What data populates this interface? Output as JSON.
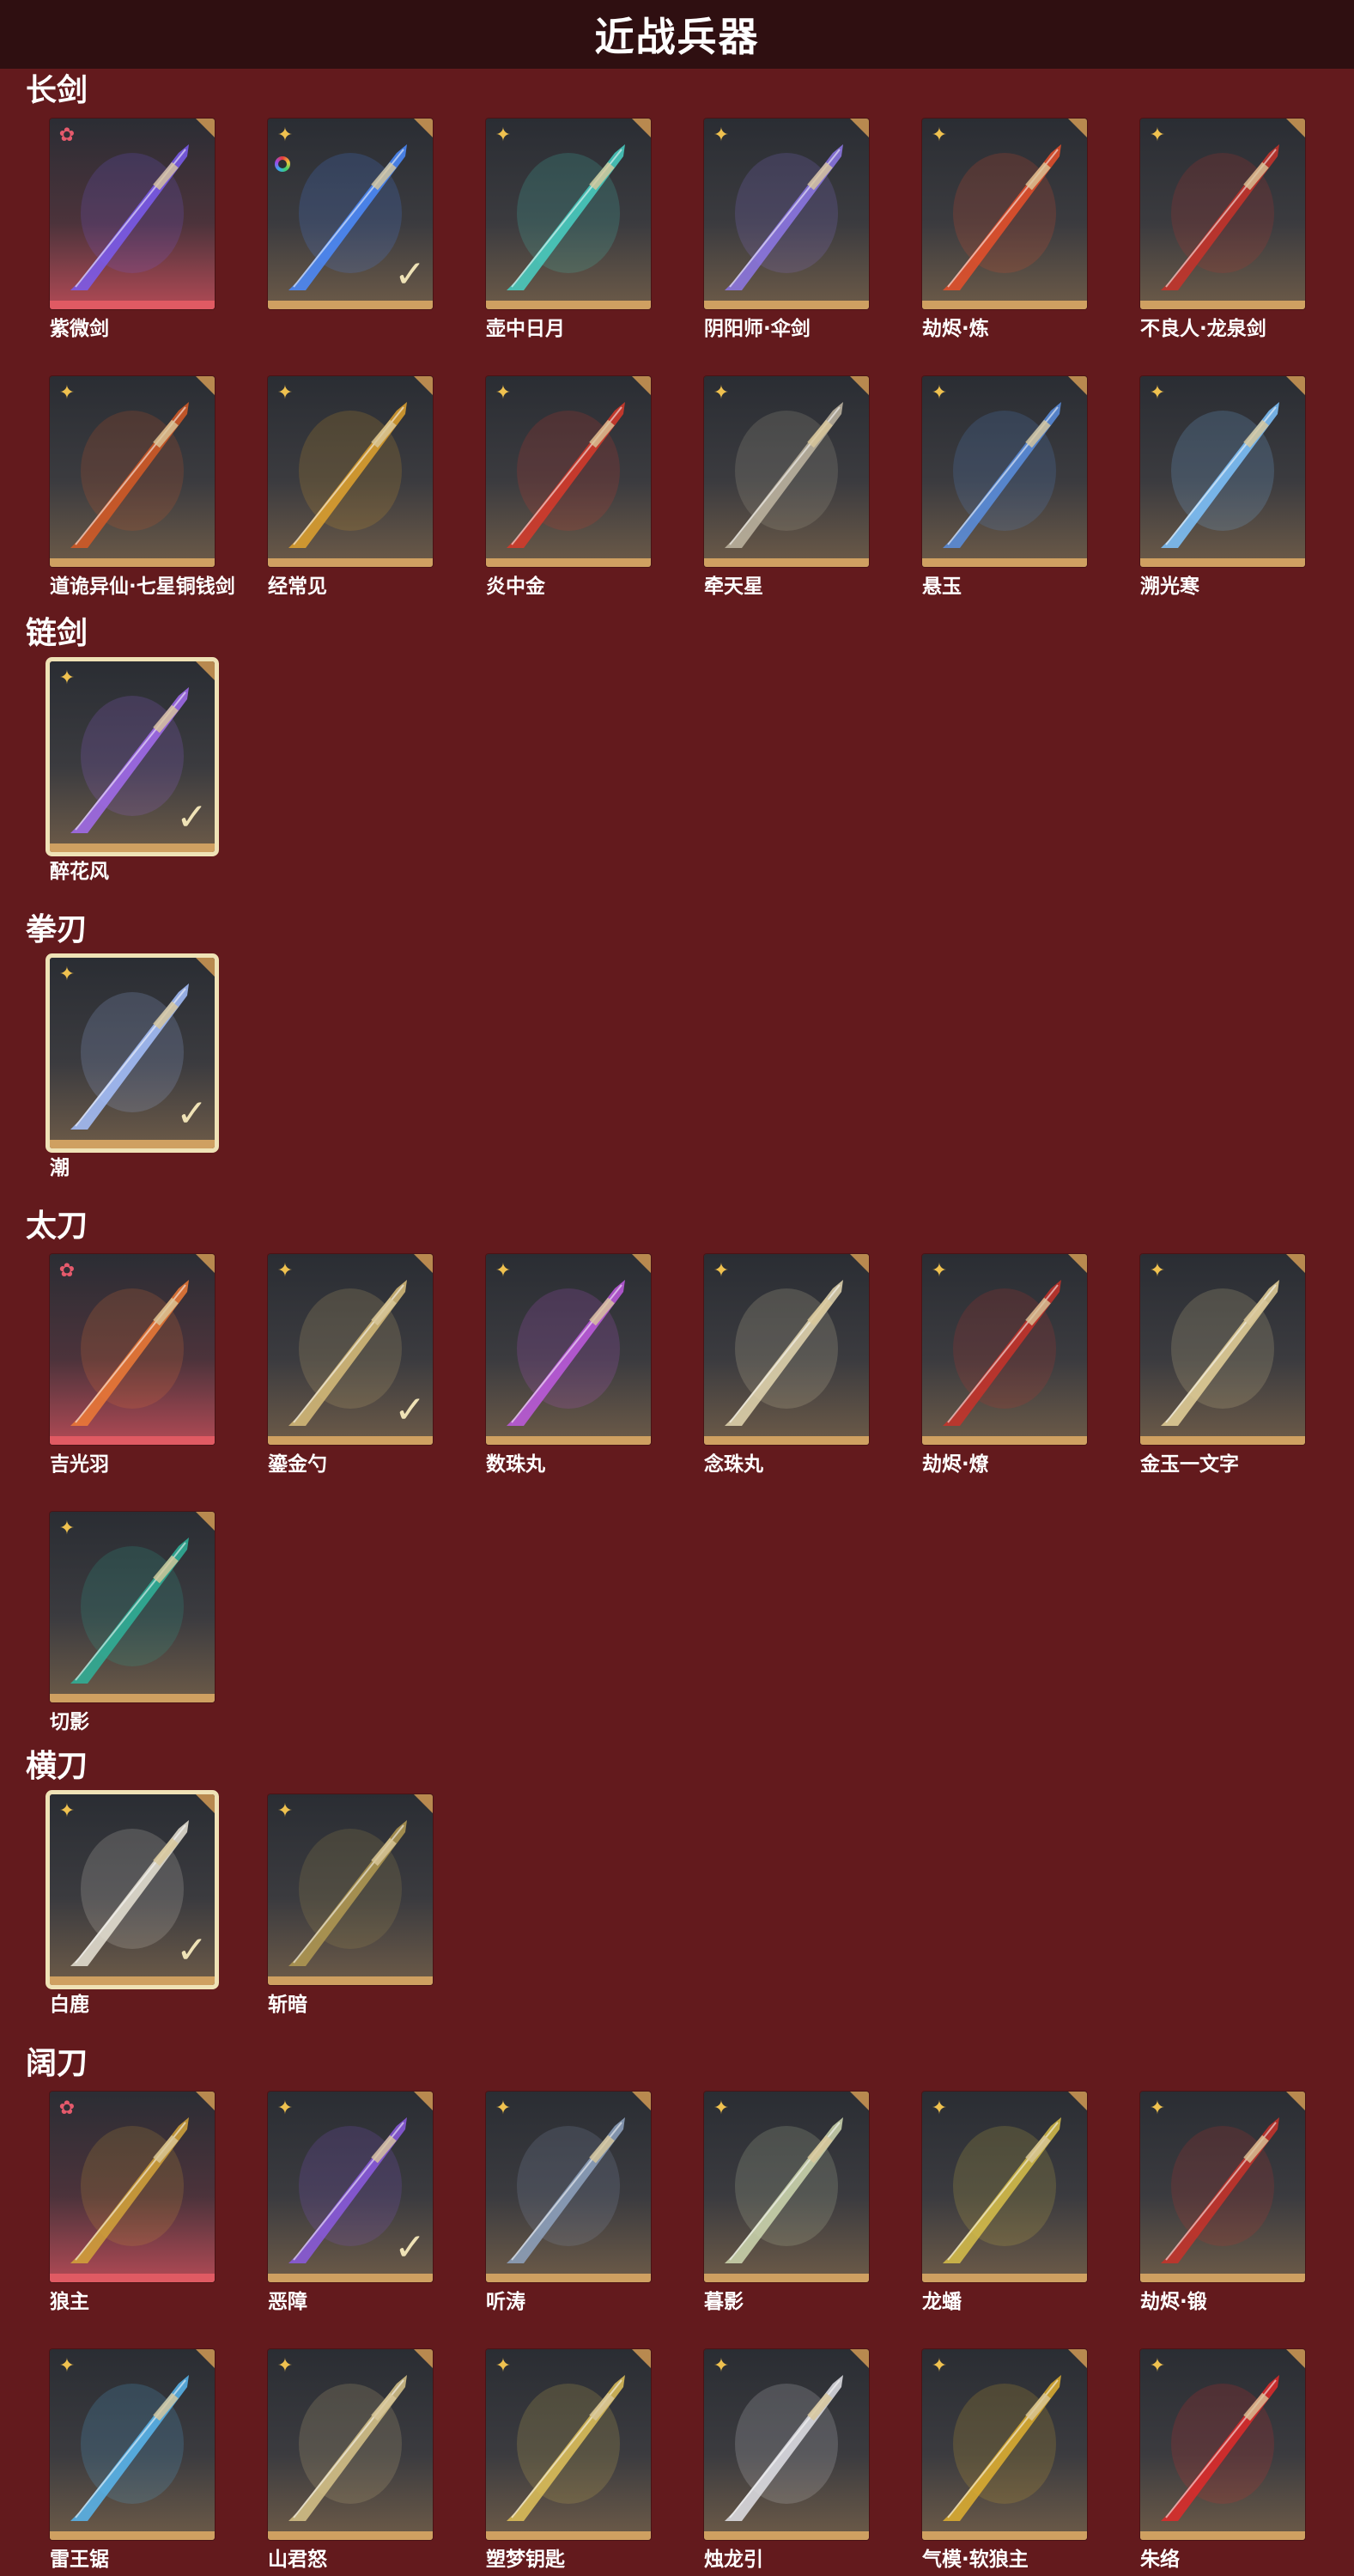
{
  "header": {
    "title": "近战兵器"
  },
  "sections": [
    {
      "title": "长剑",
      "items": [
        {
          "name": "紫微剑",
          "rarity": "pink",
          "card": "red",
          "glow": "#7b5cf0",
          "selected": false,
          "owned": false,
          "ring": false
        },
        {
          "name": "",
          "rarity": "gold",
          "card": "gold",
          "glow": "#4c8cff",
          "selected": false,
          "owned": true,
          "ring": true
        },
        {
          "name": "壶中日月",
          "rarity": "gold",
          "card": "gold",
          "glow": "#49d1c4",
          "selected": false,
          "owned": false,
          "ring": false
        },
        {
          "name": "阴阳师·伞剑",
          "rarity": "gold",
          "card": "gold",
          "glow": "#8e78e8",
          "selected": false,
          "owned": false,
          "ring": false
        },
        {
          "name": "劫烬·炼",
          "rarity": "gold",
          "card": "gold",
          "glow": "#e8502a",
          "selected": false,
          "owned": false,
          "ring": false
        },
        {
          "name": "不良人·龙泉剑",
          "rarity": "gold",
          "card": "gold",
          "glow": "#c8322a",
          "selected": false,
          "owned": false,
          "ring": false
        },
        {
          "name": "道诡异仙·七星铜钱剑",
          "rarity": "gold",
          "card": "gold",
          "glow": "#d65a26",
          "selected": false,
          "owned": false,
          "ring": false
        },
        {
          "name": "经常见",
          "rarity": "gold",
          "card": "gold",
          "glow": "#e0a22e",
          "selected": false,
          "owned": false,
          "ring": false
        },
        {
          "name": "炎中金",
          "rarity": "gold",
          "card": "gold",
          "glow": "#d83a2a",
          "selected": false,
          "owned": false,
          "ring": false
        },
        {
          "name": "牵天星",
          "rarity": "gold",
          "card": "gold",
          "glow": "#bfb6a2",
          "selected": false,
          "owned": false,
          "ring": false
        },
        {
          "name": "悬玉",
          "rarity": "gold",
          "card": "gold",
          "glow": "#5a8fe0",
          "selected": false,
          "owned": false,
          "ring": false
        },
        {
          "name": "溯光寒",
          "rarity": "gold",
          "card": "gold",
          "glow": "#7fc4ff",
          "selected": false,
          "owned": false,
          "ring": false
        }
      ]
    },
    {
      "title": "链剑",
      "items": [
        {
          "name": "醉花风",
          "rarity": "gold",
          "card": "gold",
          "glow": "#a36cf0",
          "selected": true,
          "owned": true,
          "ring": false
        }
      ]
    },
    {
      "title": "拳刃",
      "items": [
        {
          "name": "潮",
          "rarity": "gold",
          "card": "gold",
          "glow": "#a7c2ff",
          "selected": true,
          "owned": true,
          "ring": false
        }
      ]
    },
    {
      "title": "太刀",
      "items": [
        {
          "name": "吉光羽",
          "rarity": "pink",
          "card": "red",
          "glow": "#ee7a36",
          "selected": false,
          "owned": false,
          "ring": false
        },
        {
          "name": "鎏金勺",
          "rarity": "gold",
          "card": "gold",
          "glow": "#d8bd7a",
          "selected": false,
          "owned": true,
          "ring": false
        },
        {
          "name": "数珠丸",
          "rarity": "gold",
          "card": "gold",
          "glow": "#c05ae0",
          "selected": false,
          "owned": false,
          "ring": false
        },
        {
          "name": "念珠丸",
          "rarity": "gold",
          "card": "gold",
          "glow": "#e4d7b0",
          "selected": false,
          "owned": false,
          "ring": false
        },
        {
          "name": "劫烬·燎",
          "rarity": "gold",
          "card": "gold",
          "glow": "#c8322a",
          "selected": false,
          "owned": false,
          "ring": false
        },
        {
          "name": "金玉一文字",
          "rarity": "gold",
          "card": "gold",
          "glow": "#e6d29a",
          "selected": false,
          "owned": false,
          "ring": false
        },
        {
          "name": "切影",
          "rarity": "gold",
          "card": "gold",
          "glow": "#2fb39a",
          "selected": false,
          "owned": false,
          "ring": false
        }
      ]
    },
    {
      "title": "横刀",
      "items": [
        {
          "name": "白鹿",
          "rarity": "gold",
          "card": "gold",
          "glow": "#e9e4d6",
          "selected": true,
          "owned": true,
          "ring": false
        },
        {
          "name": "斩暗",
          "rarity": "gold",
          "card": "gold",
          "glow": "#b39a52",
          "selected": false,
          "owned": false,
          "ring": false
        }
      ]
    },
    {
      "title": "阔刀",
      "items": [
        {
          "name": "狼主",
          "rarity": "pink",
          "card": "red",
          "glow": "#d4a33a",
          "selected": false,
          "owned": false,
          "ring": false
        },
        {
          "name": "恶障",
          "rarity": "gold",
          "card": "gold",
          "glow": "#8c5ae0",
          "selected": false,
          "owned": true,
          "ring": false
        },
        {
          "name": "听涛",
          "rarity": "gold",
          "card": "gold",
          "glow": "#8fa3c0",
          "selected": false,
          "owned": false,
          "ring": false
        },
        {
          "name": "暮影",
          "rarity": "gold",
          "card": "gold",
          "glow": "#cfd8b0",
          "selected": false,
          "owned": false,
          "ring": false
        },
        {
          "name": "龙蟠",
          "rarity": "gold",
          "card": "gold",
          "glow": "#d8c04a",
          "selected": false,
          "owned": false,
          "ring": false
        },
        {
          "name": "劫烬·锻",
          "rarity": "gold",
          "card": "gold",
          "glow": "#c8322a",
          "selected": false,
          "owned": false,
          "ring": false
        },
        {
          "name": "雷王锯",
          "rarity": "gold",
          "card": "gold",
          "glow": "#59b7f0",
          "selected": false,
          "owned": false,
          "ring": false
        },
        {
          "name": "山君怒",
          "rarity": "gold",
          "card": "gold",
          "glow": "#d8c48a",
          "selected": false,
          "owned": false,
          "ring": false
        },
        {
          "name": "塑梦钥匙",
          "rarity": "gold",
          "card": "gold",
          "glow": "#e0c25a",
          "selected": false,
          "owned": false,
          "ring": false
        },
        {
          "name": "烛龙引",
          "rarity": "gold",
          "card": "gold",
          "glow": "#e2e2e8",
          "selected": false,
          "owned": false,
          "ring": false
        },
        {
          "name": "气模·软狼主",
          "rarity": "gold",
          "card": "gold",
          "glow": "#e0b030",
          "selected": false,
          "owned": false,
          "ring": false
        },
        {
          "name": "朱络",
          "rarity": "gold",
          "card": "gold",
          "glow": "#e02a2a",
          "selected": false,
          "owned": false,
          "ring": false
        }
      ]
    }
  ]
}
